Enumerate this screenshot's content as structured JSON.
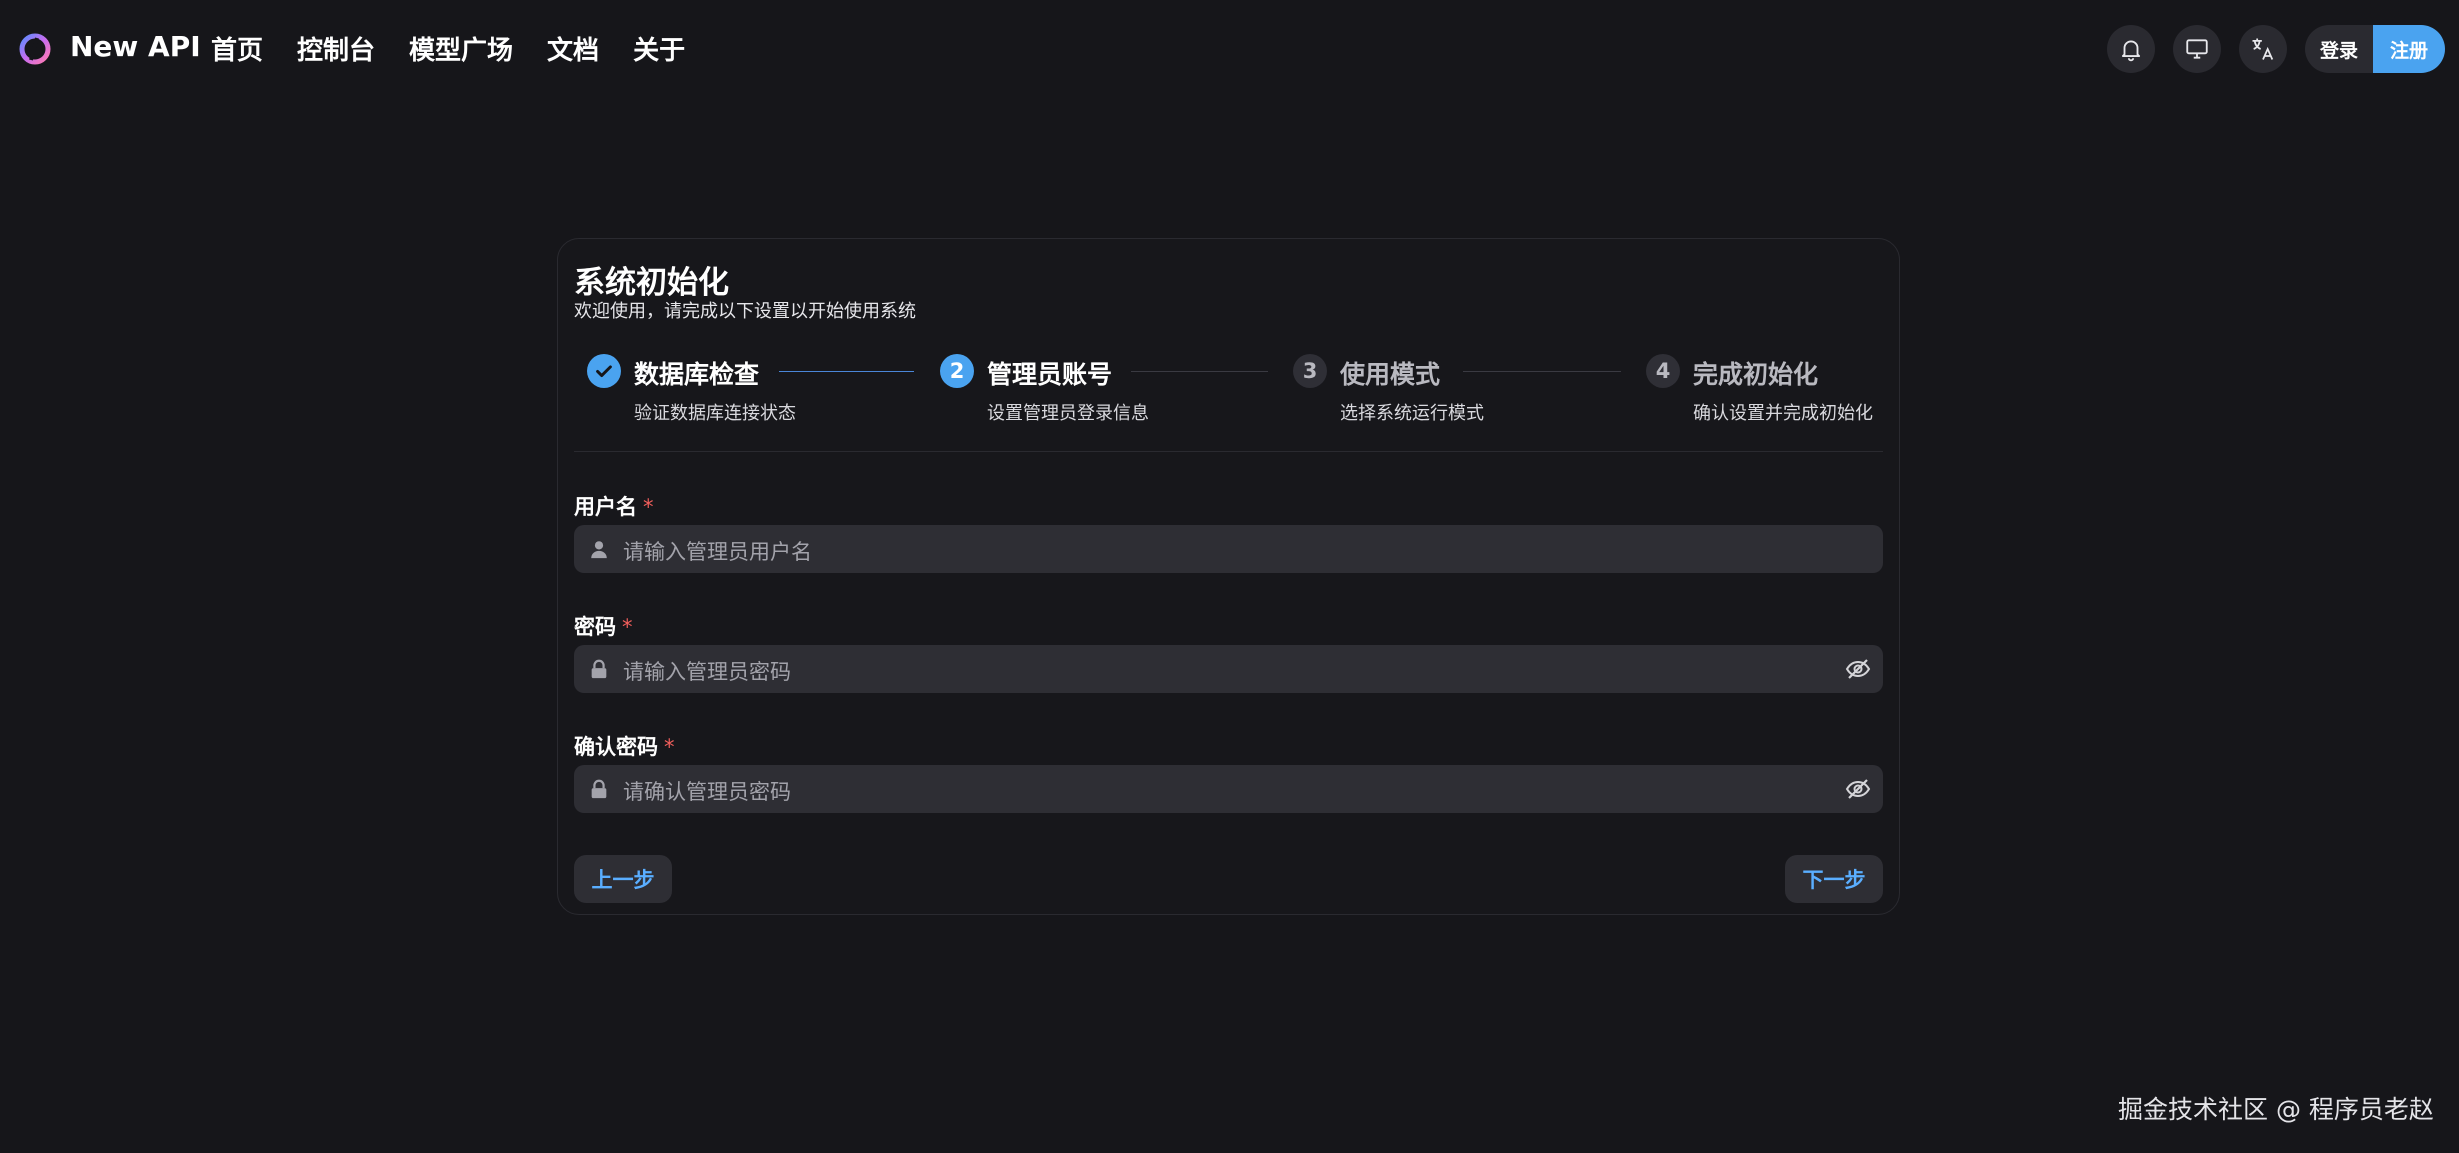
{
  "header": {
    "brand": "New API",
    "nav": [
      "首页",
      "控制台",
      "模型广场",
      "文档",
      "关于"
    ],
    "icons": [
      "bell-icon",
      "monitor-icon",
      "translate-icon"
    ],
    "login_label": "登录",
    "register_label": "注册"
  },
  "setup": {
    "title": "系统初始化",
    "subtitle": "欢迎使用，请完成以下设置以开始使用系统",
    "steps": [
      {
        "number": "1",
        "title": "数据库检查",
        "desc": "验证数据库连接状态",
        "state": "completed"
      },
      {
        "number": "2",
        "title": "管理员账号",
        "desc": "设置管理员登录信息",
        "state": "active"
      },
      {
        "number": "3",
        "title": "使用模式",
        "desc": "选择系统运行模式",
        "state": "pending"
      },
      {
        "number": "4",
        "title": "完成初始化",
        "desc": "确认设置并完成初始化",
        "state": "pending"
      }
    ],
    "fields": {
      "username": {
        "label": "用户名",
        "required_mark": "*",
        "placeholder": "请输入管理员用户名"
      },
      "password": {
        "label": "密码",
        "required_mark": "*",
        "placeholder": "请输入管理员密码"
      },
      "confirm": {
        "label": "确认密码",
        "required_mark": "*",
        "placeholder": "请确认管理员密码"
      }
    },
    "prev_label": "上一步",
    "next_label": "下一步"
  },
  "watermark": "掘金技术社区 @ 程序员老赵",
  "colors": {
    "accent": "#4aa3f0",
    "background": "#16161a",
    "input_bg": "#2e2e34",
    "required": "#f25f5c"
  }
}
